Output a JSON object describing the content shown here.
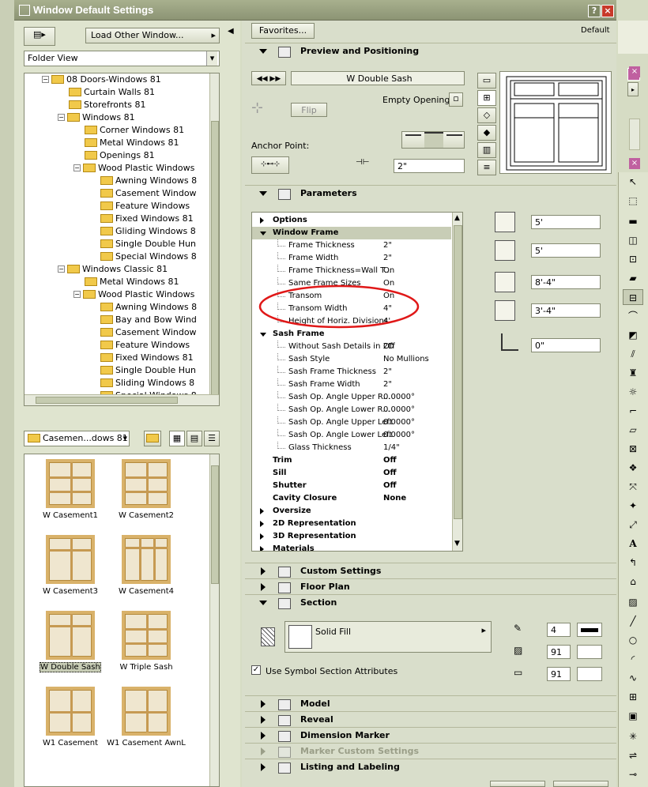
{
  "window": {
    "title": "Window Default Settings",
    "help": "?",
    "close": "×"
  },
  "left": {
    "load_other": "Load Other Window...",
    "view_mode": "Folder View",
    "folder_select": "Casemen...dows 81",
    "tree": [
      {
        "label": "08 Doors-Windows 81",
        "indent": 3,
        "expanded": true
      },
      {
        "label": "Curtain Walls 81",
        "indent": 4
      },
      {
        "label": "Storefronts 81",
        "indent": 4
      },
      {
        "label": "Windows 81",
        "indent": 4,
        "expanded": true
      },
      {
        "label": "Corner Windows 81",
        "indent": 5
      },
      {
        "label": "Metal Windows 81",
        "indent": 5
      },
      {
        "label": "Openings 81",
        "indent": 5
      },
      {
        "label": "Wood Plastic Windows",
        "indent": 5,
        "expanded": true
      },
      {
        "label": "Awning Windows 8",
        "indent": 6
      },
      {
        "label": "Casement Window",
        "indent": 6
      },
      {
        "label": "Feature Windows",
        "indent": 6
      },
      {
        "label": "Fixed Windows 81",
        "indent": 6
      },
      {
        "label": "Gliding Windows 8",
        "indent": 6
      },
      {
        "label": "Single Double Hun",
        "indent": 6
      },
      {
        "label": "Special Windows 8",
        "indent": 6
      },
      {
        "label": "Windows Classic 81",
        "indent": 4,
        "expanded": true
      },
      {
        "label": "Metal Windows 81",
        "indent": 5
      },
      {
        "label": "Wood Plastic Windows",
        "indent": 5,
        "expanded": true
      },
      {
        "label": "Awning Windows 8",
        "indent": 6
      },
      {
        "label": "Bay and Bow Wind",
        "indent": 6
      },
      {
        "label": "Casement Window",
        "indent": 6
      },
      {
        "label": "Feature Windows",
        "indent": 6
      },
      {
        "label": "Fixed Windows 81",
        "indent": 6
      },
      {
        "label": "Single Double Hun",
        "indent": 6
      },
      {
        "label": "Sliding Windows 8",
        "indent": 6
      },
      {
        "label": "Special Windows 8",
        "indent": 6
      }
    ],
    "gallery": [
      {
        "label": "W Casement1",
        "type": "grid"
      },
      {
        "label": "W Casement2",
        "type": "grid"
      },
      {
        "label": "W Casement3",
        "type": "tall"
      },
      {
        "label": "W Casement4",
        "type": "split"
      },
      {
        "label": "W Double Sash",
        "type": "double",
        "selected": true
      },
      {
        "label": "W Triple Sash",
        "type": "grid"
      },
      {
        "label": "W1 Casement",
        "type": "single"
      },
      {
        "label": "W1 Casement AwnL",
        "type": "single"
      }
    ]
  },
  "right": {
    "favorites": "Favorites...",
    "default_label": "Default",
    "preview": {
      "title": "Preview and Positioning",
      "name": "W Double Sash",
      "empty_opening": "Empty Opening",
      "flip": "Flip",
      "anchor_label": "Anchor Point:",
      "anchor_value": "2\""
    },
    "parameters": {
      "title": "Parameters",
      "rows": [
        {
          "label": "Options",
          "value": "",
          "kind": "group",
          "open": false
        },
        {
          "label": "Window Frame",
          "value": "",
          "kind": "group",
          "open": true,
          "sel": true
        },
        {
          "label": "Frame Thickness",
          "value": "2\"",
          "kind": "item"
        },
        {
          "label": "Frame Width",
          "value": "2\"",
          "kind": "item"
        },
        {
          "label": "Frame Thickness=Wall T...",
          "value": "On",
          "kind": "item"
        },
        {
          "label": "Same Frame Sizes",
          "value": "On",
          "kind": "item"
        },
        {
          "label": "Transom",
          "value": "On",
          "kind": "item"
        },
        {
          "label": "Transom Width",
          "value": "4\"",
          "kind": "item"
        },
        {
          "label": "Height of Horiz. Divisions",
          "value": "4'",
          "kind": "item"
        },
        {
          "label": "Sash Frame",
          "value": "",
          "kind": "group",
          "open": true
        },
        {
          "label": "Without Sash Details in 2D",
          "value": "Off",
          "kind": "item"
        },
        {
          "label": "Sash Style",
          "value": "No Mullions",
          "kind": "item"
        },
        {
          "label": "Sash Frame Thickness",
          "value": "2\"",
          "kind": "item"
        },
        {
          "label": "Sash Frame Width",
          "value": "2\"",
          "kind": "item"
        },
        {
          "label": "Sash Op. Angle Upper R...",
          "value": "0.0000°",
          "kind": "item"
        },
        {
          "label": "Sash Op. Angle Lower R...",
          "value": "0.0000°",
          "kind": "item"
        },
        {
          "label": "Sash Op. Angle Upper Left",
          "value": "0.0000°",
          "kind": "item"
        },
        {
          "label": "Sash Op. Angle Lower Left",
          "value": "0.0000°",
          "kind": "item"
        },
        {
          "label": "Glass Thickness",
          "value": "1/4\"",
          "kind": "item"
        },
        {
          "label": "Trim",
          "value": "Off",
          "kind": "plain"
        },
        {
          "label": "Sill",
          "value": "Off",
          "kind": "plain"
        },
        {
          "label": "Shutter",
          "value": "Off",
          "kind": "plain"
        },
        {
          "label": "Cavity Closure",
          "value": "None",
          "kind": "plain"
        },
        {
          "label": "Oversize",
          "value": "",
          "kind": "group",
          "open": false
        },
        {
          "label": "2D Representation",
          "value": "",
          "kind": "group",
          "open": false
        },
        {
          "label": "3D Representation",
          "value": "",
          "kind": "group",
          "open": false
        },
        {
          "label": "Materials",
          "value": "",
          "kind": "group",
          "open": false
        }
      ],
      "dims": [
        "5'",
        "5'",
        "8'-4\"",
        "3'-4\"",
        "0\""
      ]
    },
    "sections_mid": [
      "Custom Settings",
      "Floor Plan",
      "Section"
    ],
    "section": {
      "fill": "Solid Fill",
      "use_symbol": "Use Symbol Section Attributes",
      "pens": [
        "4",
        "91",
        "91"
      ]
    },
    "sections_bottom": [
      "Model",
      "Reveal",
      "Dimension Marker",
      "Marker Custom Settings",
      "Listing and Labeling"
    ]
  },
  "colors": {
    "highlight_red": "#e01818",
    "title_bar": "#8c9474",
    "pane_bg": "#d9decb"
  }
}
